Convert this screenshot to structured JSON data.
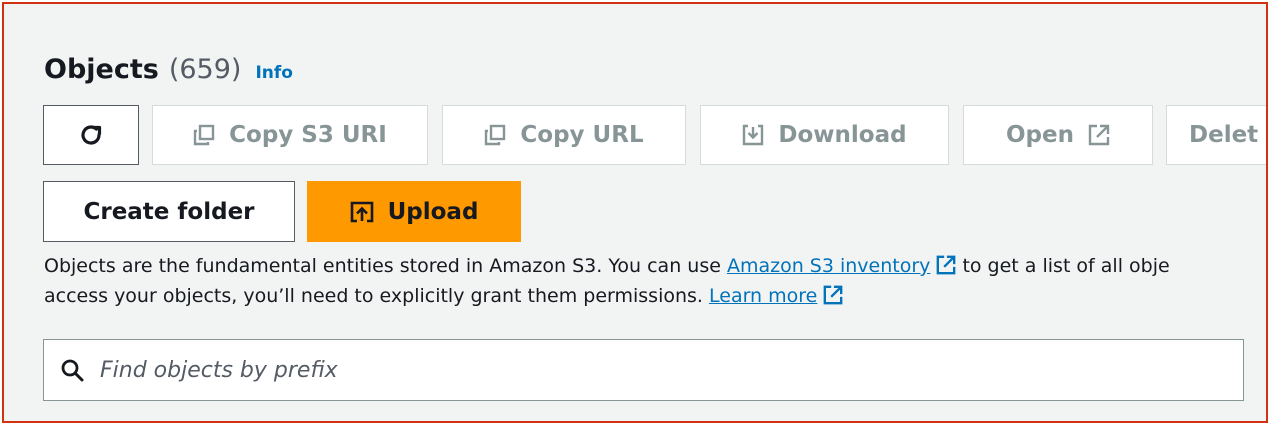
{
  "header": {
    "title": "Objects",
    "count": "(659)",
    "info_link": "Info"
  },
  "toolbar": {
    "refresh_icon": "refresh-icon",
    "copy_s3_uri": "Copy S3 URI",
    "copy_url": "Copy URL",
    "download": "Download",
    "open": "Open",
    "delete_partial": "Delet",
    "create_folder": "Create folder",
    "upload": "Upload"
  },
  "description": {
    "part1": "Objects are the fundamental entities stored in Amazon S3. You can use ",
    "inventory_link": "Amazon S3 inventory",
    "part2": " to get a list of all obje",
    "part3": "access your objects, you’ll need to explicitly grant them permissions. ",
    "learn_more_link": "Learn more"
  },
  "search": {
    "placeholder": "Find objects by prefix"
  },
  "colors": {
    "primary_button": "#ff9900",
    "link": "#0073bb",
    "frame_border": "#d13212",
    "disabled_text": "#879596"
  }
}
